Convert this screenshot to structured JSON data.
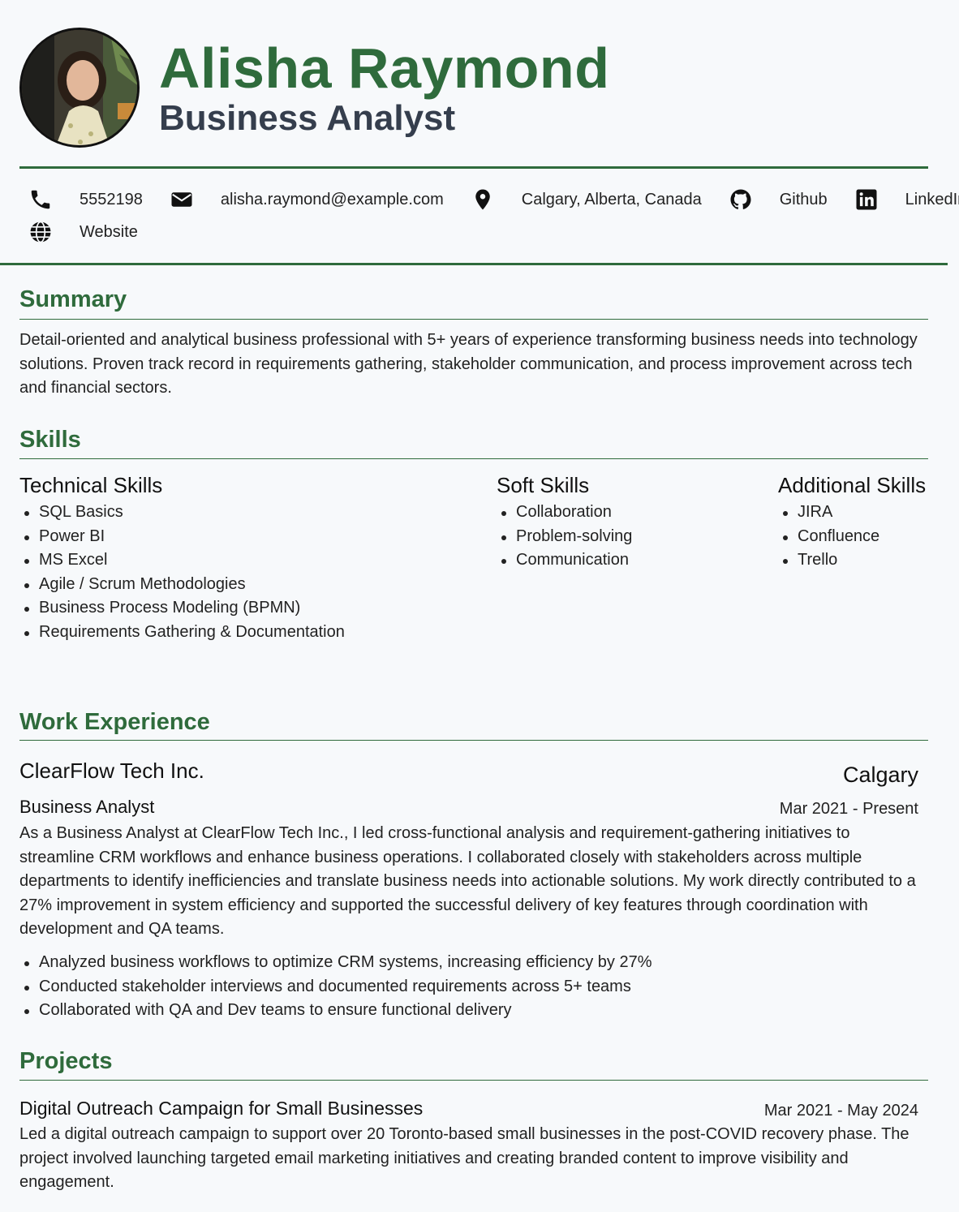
{
  "profile": {
    "name": "Alisha Raymond",
    "title": "Business Analyst"
  },
  "contacts": [
    {
      "icon": "phone-icon",
      "text": "5552198"
    },
    {
      "icon": "envelope-icon",
      "text": "alisha.raymond@example.com"
    },
    {
      "icon": "map-pin-icon",
      "text": "Calgary, Alberta, Canada"
    },
    {
      "icon": "github-icon",
      "text": "Github"
    },
    {
      "icon": "linkedin-icon",
      "text": "LinkedIn"
    },
    {
      "icon": "globe-icon",
      "text": "Website"
    }
  ],
  "summary": {
    "heading": "Summary",
    "text": "Detail-oriented and analytical business professional with 5+ years of experience transforming business needs into technology solutions. Proven track record in requirements gathering, stakeholder communication, and process improvement across tech and financial sectors."
  },
  "skills": {
    "heading": "Skills",
    "groups": [
      {
        "title": "Technical Skills",
        "items": [
          "SQL Basics",
          "Power BI",
          "MS Excel",
          "Agile / Scrum Methodologies",
          "Business Process Modeling (BPMN)",
          "Requirements Gathering & Documentation"
        ]
      },
      {
        "title": "Soft Skills",
        "items": [
          "Collaboration",
          "Problem-solving",
          "Communication"
        ]
      },
      {
        "title": "Additional Skills",
        "items": [
          "JIRA",
          "Confluence",
          "Trello"
        ]
      }
    ]
  },
  "experience": {
    "heading": "Work Experience",
    "company": "ClearFlow Tech Inc.",
    "location": "Calgary",
    "role": "Business Analyst",
    "dates": "Mar 2021 - Present",
    "description": "As a Business Analyst at ClearFlow Tech Inc., I led cross-functional analysis and requirement-gathering initiatives to streamline CRM workflows and enhance business operations. I collaborated closely with stakeholders across multiple departments to identify inefficiencies and translate business needs into actionable solutions. My work directly contributed to a 27% improvement in system efficiency and supported the successful delivery of key features through coordination with development and QA teams.",
    "bullets": [
      "Analyzed business workflows to optimize CRM systems, increasing efficiency by 27%",
      "Conducted stakeholder interviews and documented requirements across 5+ teams",
      "Collaborated with QA and Dev teams to ensure functional delivery"
    ]
  },
  "projects": {
    "heading": "Projects",
    "name": "Digital Outreach Campaign for Small Businesses",
    "dates": "Mar 2021 - May 2024",
    "description": "Led a digital outreach campaign to support over 20 Toronto-based small businesses in the post-COVID recovery phase. The project involved launching targeted email marketing initiatives and creating branded content to improve visibility and engagement."
  },
  "colors": {
    "accent": "#2f6b3c",
    "title": "#353e4d",
    "background": "#f7f9fb"
  }
}
